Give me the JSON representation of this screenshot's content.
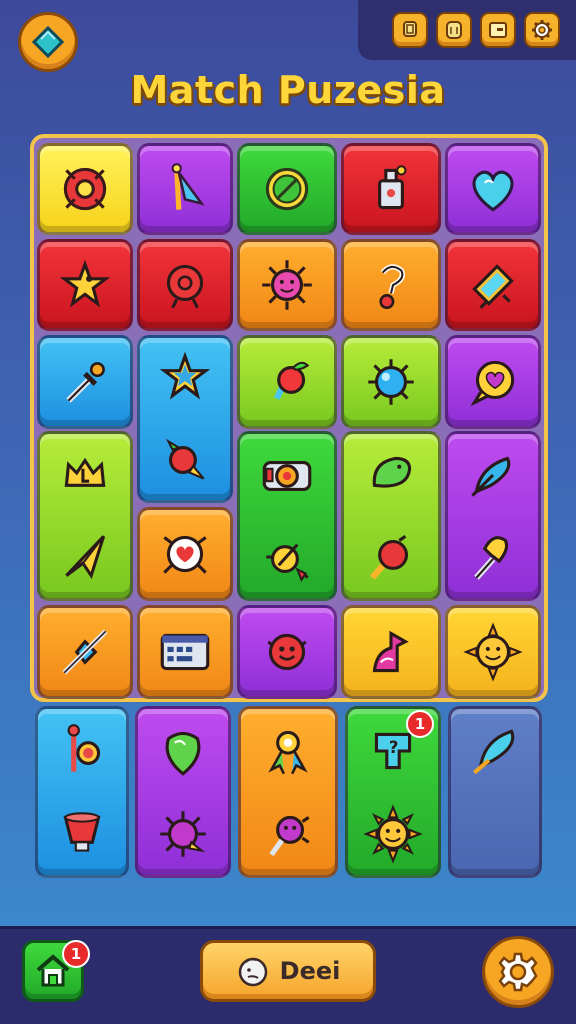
{
  "game": {
    "title": "Match Puzesia"
  },
  "top_bar": {
    "buttons": [
      {
        "icon": "back-diamond-icon"
      },
      {
        "icon": "trophy-icon"
      },
      {
        "icon": "card-icon"
      },
      {
        "icon": "shop-icon"
      },
      {
        "icon": "gear-icon"
      }
    ]
  },
  "board": {
    "columns": 5,
    "tiles": [
      {
        "color": "yellow",
        "icon": "donut-icon"
      },
      {
        "color": "purple",
        "icon": "pennant-icon"
      },
      {
        "color": "green",
        "icon": "ring-icon"
      },
      {
        "color": "red",
        "icon": "bottle-icon"
      },
      {
        "color": "purple",
        "icon": "heart-gem-icon"
      },
      {
        "color": "red",
        "icon": "star-icon"
      },
      {
        "color": "red",
        "icon": "balloon-icon"
      },
      {
        "color": "orange",
        "icon": "sun-face-icon"
      },
      {
        "color": "orange",
        "icon": "question-hook-icon"
      },
      {
        "color": "red",
        "icon": "tablet-icon"
      },
      {
        "color": "cyan",
        "icon": "dagger-icon"
      },
      {
        "color": "cyan",
        "icon": "star-outline-icon"
      },
      {
        "color": "lime",
        "icon": "strawberry-icon"
      },
      {
        "color": "lime",
        "icon": "blue-orb-icon"
      },
      {
        "color": "purple",
        "icon": "heart-bubble-icon"
      },
      {
        "color": "lime",
        "icon": "crown-badge-icon"
      },
      {
        "color": "cyan",
        "icon": "rocket-berry-icon"
      },
      {
        "color": "green",
        "icon": "camera-icon"
      },
      {
        "color": "lime",
        "icon": "leaf-icon"
      },
      {
        "color": "purple",
        "icon": "feather-icon"
      },
      {
        "color": "lime",
        "icon": "paper-plane-icon"
      },
      {
        "color": "orange",
        "icon": "heart-sign-icon"
      },
      {
        "color": "green",
        "icon": "compass-icon"
      },
      {
        "color": "lime",
        "icon": "cherry-pin-icon"
      },
      {
        "color": "purple",
        "icon": "ice-cream-icon"
      },
      {
        "color": "orange",
        "icon": "spark-sword-icon"
      },
      {
        "color": "orange",
        "icon": "keyboard-icon"
      },
      {
        "color": "purple",
        "icon": "smile-ball-icon"
      },
      {
        "color": "yellow",
        "icon": "music-note-icon"
      },
      {
        "color": "yellow",
        "icon": "sun-smile-icon"
      },
      {
        "color": "cyan",
        "icon": "medal-icon"
      },
      {
        "color": "cyan",
        "icon": "cup-icon"
      },
      {
        "color": "purple",
        "icon": "gem-leaf-icon"
      },
      {
        "color": "purple",
        "icon": "star-mine-icon"
      },
      {
        "color": "orange",
        "icon": "ribbon-icon"
      },
      {
        "color": "orange",
        "icon": "bug-icon"
      },
      {
        "color": "green",
        "icon": "mystery-block-icon",
        "badge": "1"
      },
      {
        "color": "green",
        "icon": "sun-icon"
      },
      {
        "color": "slate",
        "icon": "feather-pen-icon"
      }
    ]
  },
  "bottom_bar": {
    "home_badge": "1",
    "deal_label": "Deei",
    "icons": [
      "home-icon",
      "face-icon",
      "gear-icon"
    ]
  }
}
